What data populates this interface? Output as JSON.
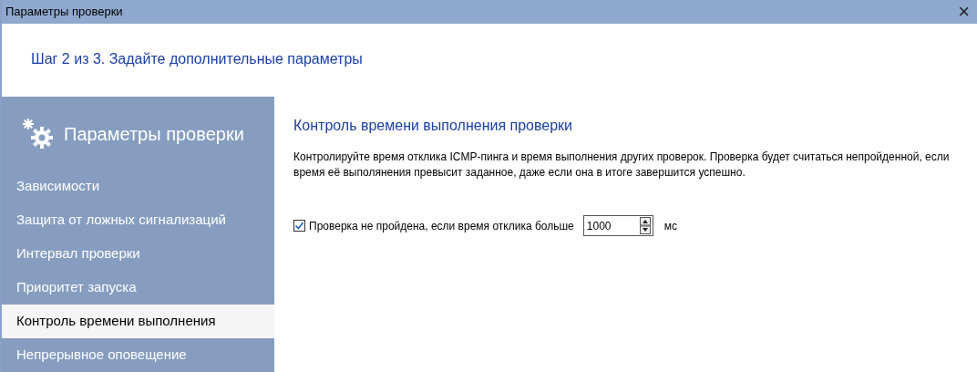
{
  "window": {
    "title": "Параметры проверки",
    "close": "×"
  },
  "step": "Шаг 2 из 3. Задайте дополнительные параметры",
  "sidebar": {
    "title": "Параметры проверки",
    "items": [
      {
        "label": "Зависимости",
        "selected": false
      },
      {
        "label": "Защита от ложных сигнализаций",
        "selected": false
      },
      {
        "label": "Интервал проверки",
        "selected": false
      },
      {
        "label": "Приоритет запуска",
        "selected": false
      },
      {
        "label": "Контроль времени выполнения",
        "selected": true
      },
      {
        "label": "Непрерывное оповещение",
        "selected": false
      }
    ]
  },
  "content": {
    "heading": "Контроль времени выполнения проверки",
    "description": "Контролируйте время отклика ICMP-пинга и время выполнения других проверок. Проверка будет считаться непройденной, если время её выполянения превысит заданное, даже если она в итоге завершится успешно.",
    "option": {
      "label": "Проверка не пройдена, если время отклика больше",
      "checked": true,
      "value": "1000",
      "unit": "мс"
    }
  }
}
